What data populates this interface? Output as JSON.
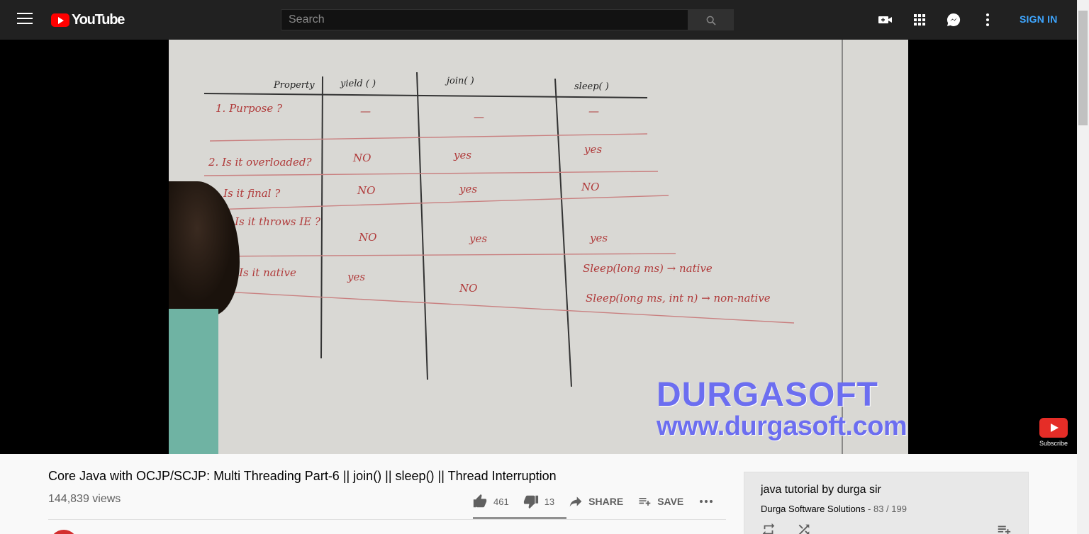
{
  "header": {
    "logo_text": "YouTube",
    "search_placeholder": "Search",
    "sign_in": "SIGN IN",
    "icons": [
      "menu-icon",
      "youtube-logo-icon",
      "search-icon",
      "create-video-icon",
      "apps-icon",
      "messages-icon",
      "more-vert-icon"
    ]
  },
  "video": {
    "watermark_line1": "DURGASOFT",
    "watermark_line2": "www.durgasoft.com",
    "subscribe_label": "Subscribe",
    "whiteboard": {
      "headers": [
        "Property",
        "yield ( )",
        "join( )",
        "sleep( )"
      ],
      "rows": [
        [
          "1. Purpose ?",
          "—",
          "—",
          "—"
        ],
        [
          "2. Is it overloaded?",
          "NO",
          "yes",
          "yes"
        ],
        [
          "3. Is it final ?",
          "NO",
          "yes",
          "NO"
        ],
        [
          "4. Is it throws IE ?",
          "NO",
          "yes",
          "yes"
        ],
        [
          "5. Is it native",
          "yes",
          "NO",
          "Sleep(long ms) → native"
        ]
      ],
      "extra_note": "Sleep(long ms, int n) → non-native"
    }
  },
  "info": {
    "title": "Core Java with OCJP/SCJP: Multi Threading Part-6 || join() || sleep() || Thread Interruption",
    "views": "144,839 views",
    "likes": "461",
    "dislikes": "13",
    "share_label": "SHARE",
    "save_label": "SAVE"
  },
  "playlist": {
    "title": "java tutorial by durga sir",
    "channel": "Durga Software Solutions",
    "position": " - 83 / 199"
  },
  "colors": {
    "topbar": "#212121",
    "sign_in": "#3ea6ff",
    "logo_red": "#ff0000",
    "watermark": "#6c6ef0",
    "ink": "#c0392b"
  }
}
